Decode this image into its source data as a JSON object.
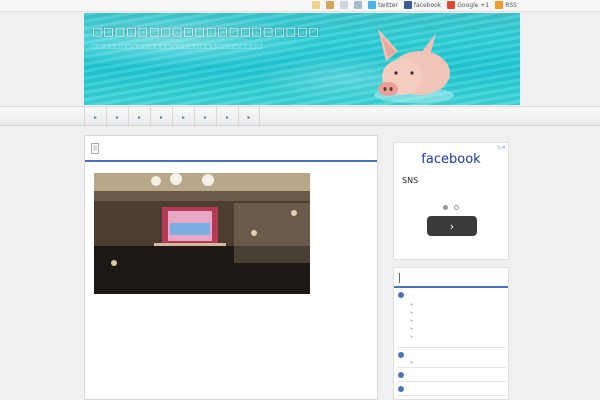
{
  "topbar": {
    "links": [
      {
        "icon": "twitter-icon",
        "label": "twitter",
        "color": "#4ab3e6"
      },
      {
        "icon": "facebook-icon",
        "label": "facebook",
        "color": "#3b5998"
      },
      {
        "icon": "google-icon",
        "label": "Google +1",
        "color": "#dd4b39"
      },
      {
        "icon": "rss-icon",
        "label": "RSS",
        "color": "#f29a2e"
      }
    ]
  },
  "header": {
    "title": "□□□□□□□□□□□□□□□□□□□□",
    "description": "□□□□□□□□□□□□□□□□□□□□□□□□□□□□□□"
  },
  "nav": {
    "items": [
      "▸",
      "▸",
      "▸",
      "▸",
      "▸",
      "▸",
      "▸",
      "▸"
    ]
  },
  "ad": {
    "title": "facebook",
    "subtitle": "SNS",
    "close": "▷✕",
    "next": "›"
  },
  "colors": {
    "accent": "#4a73b8",
    "brand_facebook": "#1a3aa6"
  }
}
